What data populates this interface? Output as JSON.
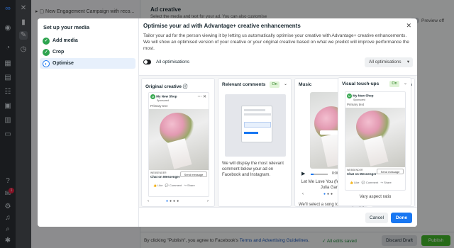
{
  "rail": {
    "logo": "meta-logo"
  },
  "campaign": {
    "title": "New Engagement Campaign with reco..."
  },
  "adcreative": {
    "title": "Ad creative",
    "subtitle": "Select the media and text for your ad. You can also customise",
    "preview": "Preview off"
  },
  "badge_count": "1",
  "footer": {
    "prefix": "By clicking \"Publish\", you agree to Facebook's ",
    "link": "Terms and Advertising Guidelines",
    "suffix": ".",
    "saved": "All edits saved",
    "discard": "Discard Draft",
    "publish": "Publish"
  },
  "modal": {
    "sidebar_title": "Set up your media",
    "steps": [
      {
        "label": "Add media",
        "state": "done"
      },
      {
        "label": "Crop",
        "state": "done"
      },
      {
        "label": "Optimise",
        "state": "current"
      }
    ],
    "title": "Optimise your ad with Advantage+ creative enhancements",
    "description": "Tailor your ad for the person viewing it by letting us automatically optimise your creative with Advantage+ creative enhancements. We will show an optimised version of your creative or your original creative based on what we predict will improve performance the most.",
    "all_label": "All optimisations",
    "all_select": "All optimisations",
    "cancel": "Cancel",
    "done": "Done",
    "cards": [
      {
        "title": "Original creative",
        "shop": "My New Shop",
        "sponsored": "Sponsored",
        "primary": "Primary text",
        "cta_label": "WEBSENDER",
        "cta_text": "Chat on Messenger",
        "send": "Send message",
        "like": "Like",
        "comment": "Comment",
        "share": "Share"
      },
      {
        "title": "Relevant comments",
        "on": "On",
        "text": "We will display the most relevant comment below your ad on Facebook and Instagram."
      },
      {
        "title": "Music",
        "on": "On",
        "time": "0:00 / 2:58",
        "song": "Let Me Love You (feat. Ariza), by Julia Gartha",
        "text": "We'll select a song to accompany your"
      },
      {
        "title": "Visual touch-ups",
        "on": "On",
        "shop": "My New Shop",
        "sponsored": "Sponsored",
        "primary": "Primary text",
        "cta_label": "WEBSENDER",
        "cta_text": "Chat on Messenger",
        "send": "Send message",
        "like": "Like",
        "comment": "Comment",
        "share": "Share",
        "aspect": "Vary aspect ratio"
      }
    ]
  }
}
